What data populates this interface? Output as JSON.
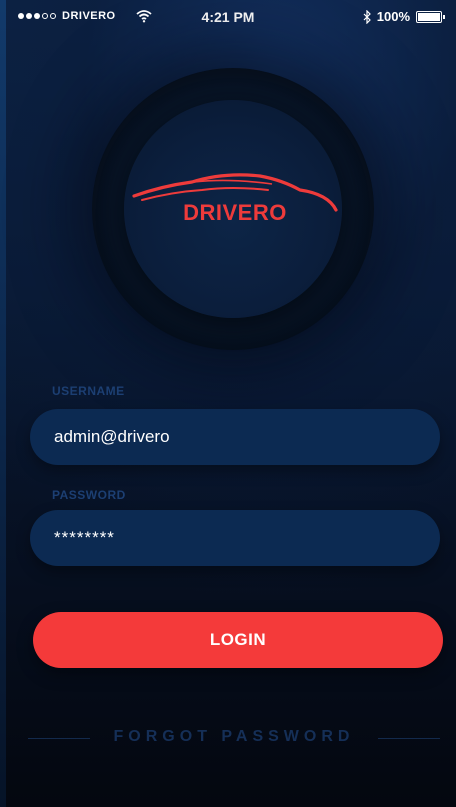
{
  "status_bar": {
    "carrier": "DRIVERO",
    "time": "4:21 PM",
    "battery": "100%",
    "icons": [
      "signal-dots-icon",
      "wifi-icon",
      "bluetooth-icon",
      "battery-icon"
    ]
  },
  "logo": {
    "text": "DRIVERO",
    "icon": "car-silhouette-icon",
    "color": "#ee3b3b"
  },
  "form": {
    "username_label": "USERNAME",
    "username_value": "admin@drivero",
    "password_label": "PASSWORD",
    "password_value": "********",
    "login_label": "LOGIN",
    "forgot_label": "FORGOT PASSWORD"
  },
  "colors": {
    "accent": "#f43a3a",
    "field_bg": "#0c2a52",
    "label": "#1c3f73",
    "background_top": "#0d2446",
    "background_bottom": "#04070f"
  }
}
